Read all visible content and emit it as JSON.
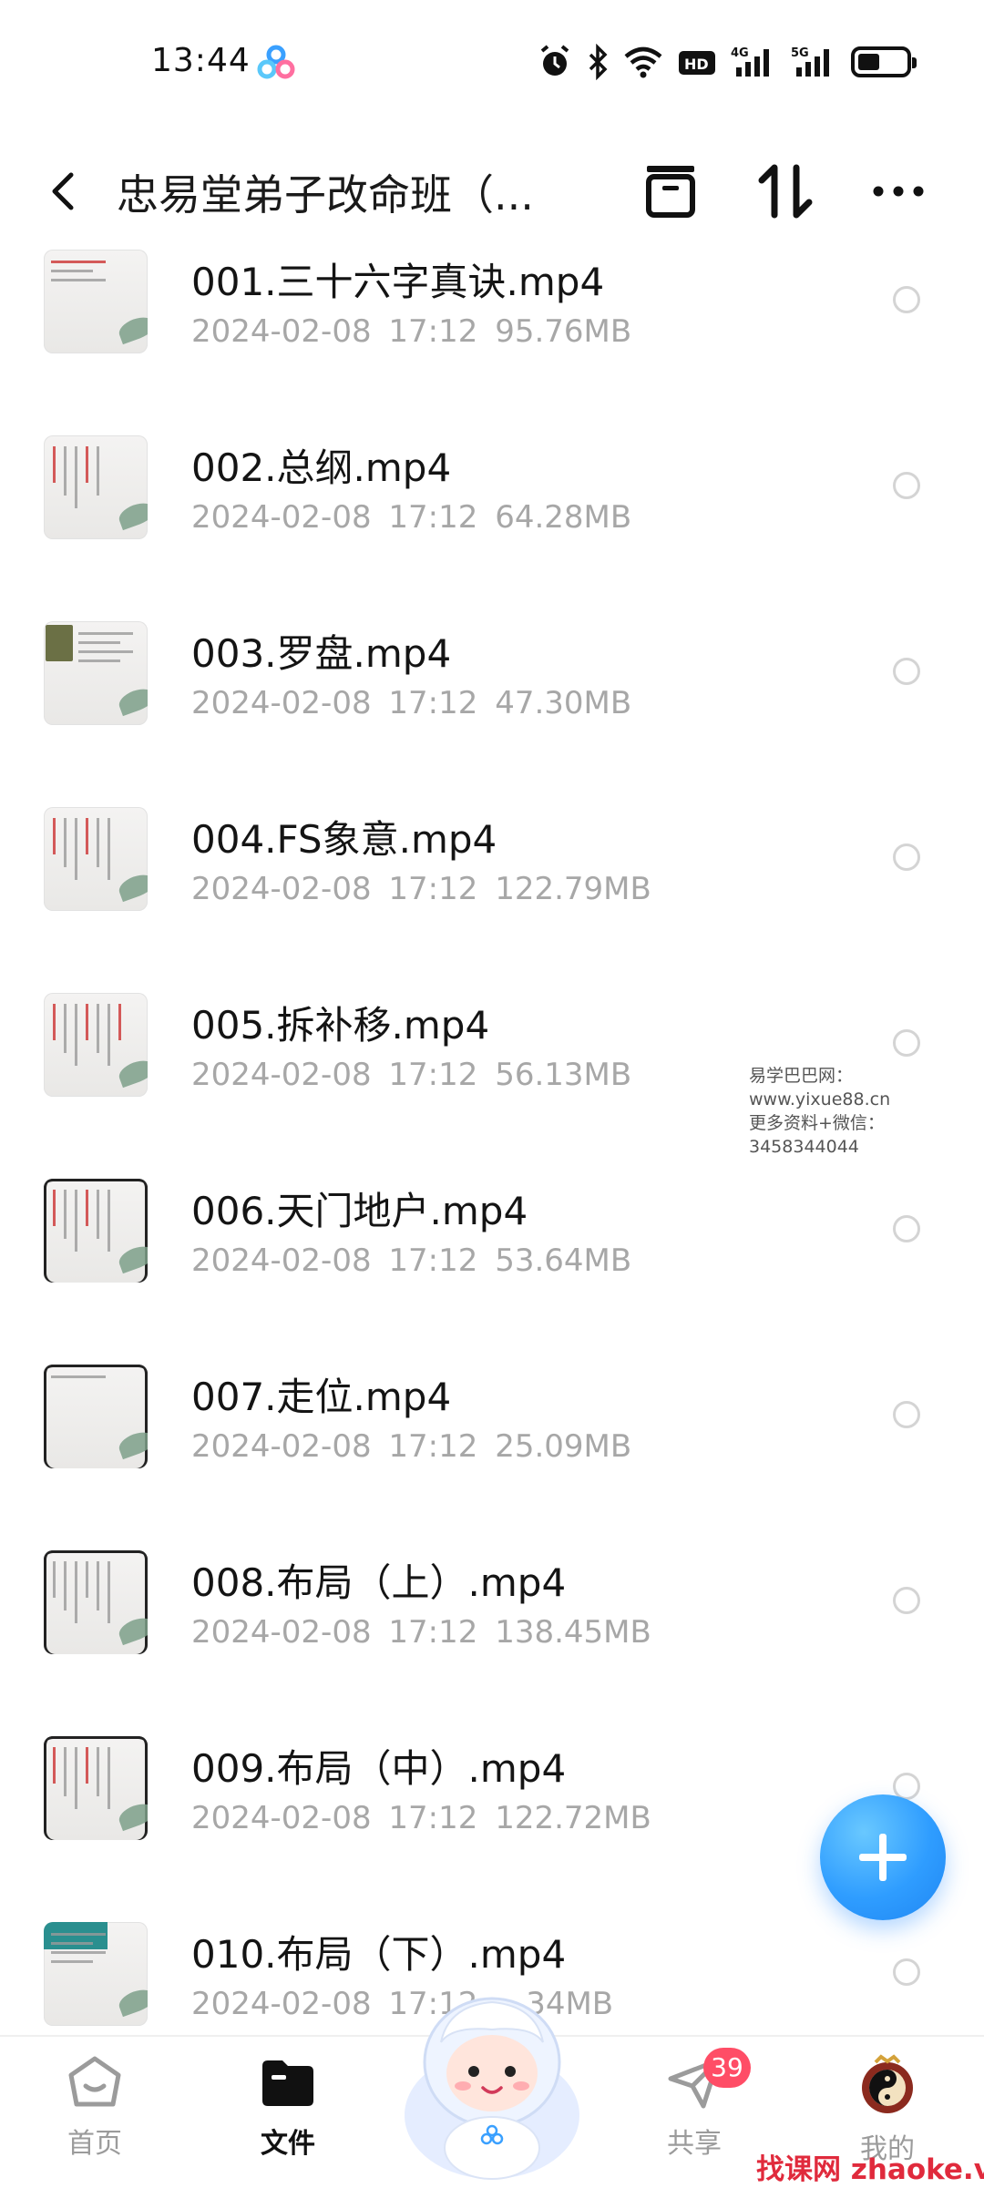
{
  "status_bar": {
    "time": "13:44",
    "battery_level": 0.45
  },
  "header": {
    "title": "忠易堂弟子改命班（...",
    "icons": [
      "back-icon",
      "archive-icon",
      "sort-icon",
      "more-icon"
    ]
  },
  "files": [
    {
      "name": "001.三十六字真诀.mp4",
      "date": "2024-02-08",
      "time": "17:12",
      "size": "95.76MB"
    },
    {
      "name": "002.总纲.mp4",
      "date": "2024-02-08",
      "time": "17:12",
      "size": "64.28MB"
    },
    {
      "name": "003.罗盘.mp4",
      "date": "2024-02-08",
      "time": "17:12",
      "size": "47.30MB"
    },
    {
      "name": "004.FS象意.mp4",
      "date": "2024-02-08",
      "time": "17:12",
      "size": "122.79MB"
    },
    {
      "name": "005.拆补移.mp4",
      "date": "2024-02-08",
      "time": "17:12",
      "size": "56.13MB"
    },
    {
      "name": "006.天门地户.mp4",
      "date": "2024-02-08",
      "time": "17:12",
      "size": "53.64MB"
    },
    {
      "name": "007.走位.mp4",
      "date": "2024-02-08",
      "time": "17:12",
      "size": "25.09MB"
    },
    {
      "name": "008.布局（上）.mp4",
      "date": "2024-02-08",
      "time": "17:12",
      "size": "138.45MB"
    },
    {
      "name": "009.布局（中）.mp4",
      "date": "2024-02-08",
      "time": "17:12",
      "size": "122.72MB"
    },
    {
      "name": "010.布局（下）.mp4",
      "date": "2024-02-08",
      "time": "17:12",
      "size": "…34MB"
    }
  ],
  "watermarks": {
    "line1": "易学巴巴网：www.yixue88.cn",
    "line2": "更多资料+微信：3458344044",
    "bottom": "找课网 zhaoke.vip"
  },
  "fab": {
    "icon": "plus-icon"
  },
  "bottom_nav": {
    "home": {
      "label": "首页",
      "icon": "home-icon"
    },
    "files": {
      "label": "文件",
      "icon": "folder-icon"
    },
    "center": {
      "icon": "mascot-icon"
    },
    "share": {
      "label": "共享",
      "icon": "paper-plane-icon",
      "badge": "39"
    },
    "mine": {
      "label": "我的",
      "icon": "avatar-icon"
    }
  },
  "colors": {
    "accent": "#2f9dff",
    "badge": "#ff4d66",
    "meta_text": "#a7a7a7",
    "watermark_red": "#e02a3c"
  }
}
